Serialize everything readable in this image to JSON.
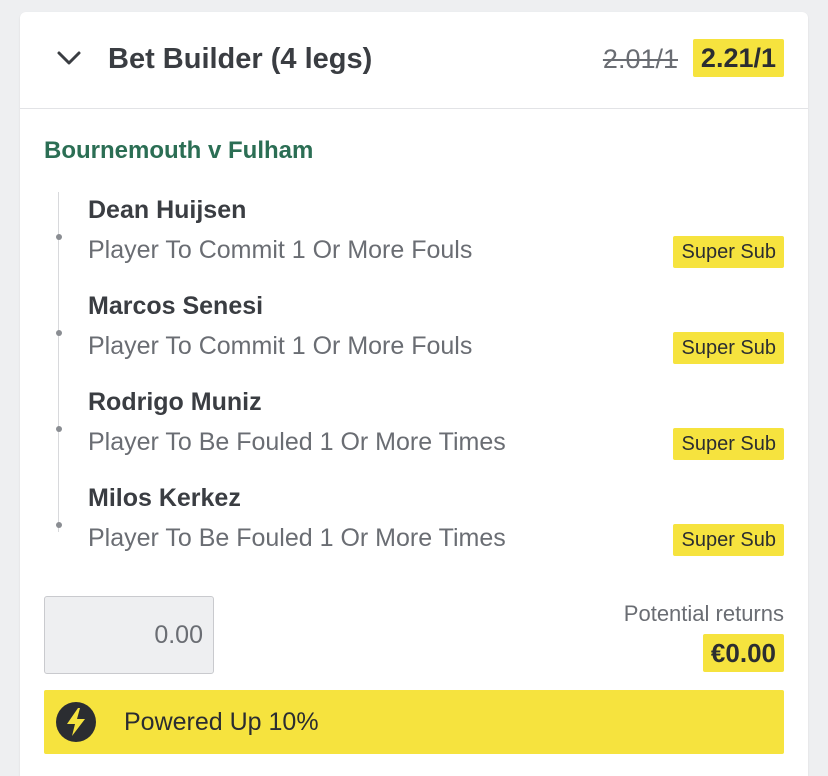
{
  "header": {
    "title": "Bet Builder (4 legs)",
    "old_odds": "2.01/1",
    "new_odds": "2.21/1"
  },
  "match": {
    "title": "Bournemouth v Fulham"
  },
  "legs": [
    {
      "player": "Dean Huijsen",
      "market": "Player To Commit 1 Or More Fouls",
      "badge": "Super Sub"
    },
    {
      "player": "Marcos Senesi",
      "market": "Player To Commit 1 Or More Fouls",
      "badge": "Super Sub"
    },
    {
      "player": "Rodrigo Muniz",
      "market": "Player To Be Fouled 1 Or More Times",
      "badge": "Super Sub"
    },
    {
      "player": "Milos Kerkez",
      "market": "Player To Be Fouled 1 Or More Times",
      "badge": "Super Sub"
    }
  ],
  "stake": {
    "placeholder": "0.00"
  },
  "returns": {
    "label": "Potential returns",
    "value": "€0.00"
  },
  "boost": {
    "label": "Powered Up 10%",
    "icon": "lightning-bolt-icon"
  },
  "colors": {
    "accent_yellow": "#f6e33e",
    "match_green": "#2b6e54",
    "text_dark": "#3a3d42",
    "text_muted": "#6a6d73",
    "background": "#eeeff1"
  }
}
